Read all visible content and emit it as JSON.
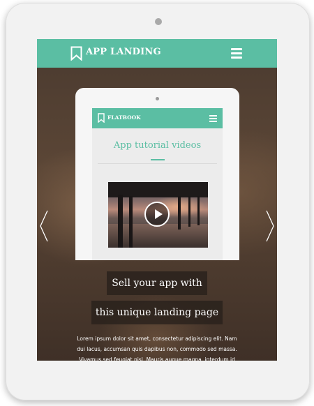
{
  "app": {
    "brand": "APP LANDING",
    "brand_icon": "bookmark-icon",
    "menu_icon": "hamburger-menu-icon"
  },
  "preview": {
    "brand": "FLATBOOK",
    "title": "App tutorial videos",
    "video_icon": "play-icon"
  },
  "hero": {
    "line1": "Sell your app with",
    "line2": "this unique landing page",
    "body1": "Lorem ipsum dolor sit amet, consectetur adipiscing elit. Nam",
    "body2": "dui lacus, accumsan quis dapibus non, commodo sed massa.",
    "body3": "Vivamus sed feugiat nisl. Mauris augue magna, interdum id"
  },
  "carousel": {
    "prev_icon": "chevron-left-icon",
    "next_icon": "chevron-right-icon"
  },
  "colors": {
    "accent": "#5bbea3",
    "frame": "#f2f2f2"
  }
}
